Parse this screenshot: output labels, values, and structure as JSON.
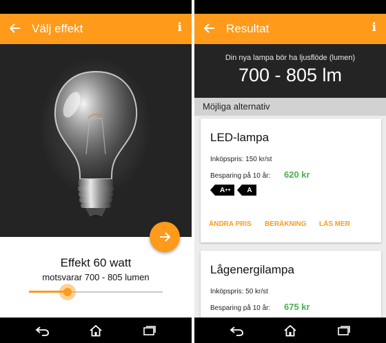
{
  "left_screen": {
    "appbar": {
      "title": "Välj effekt",
      "info": "i"
    },
    "effect_label": "Effekt 60 watt",
    "lumen_label": "motsvarar 700 - 805 lumen",
    "slider": {
      "value_fraction": 0.29
    }
  },
  "right_screen": {
    "appbar": {
      "title": "Resultat",
      "info": "i"
    },
    "header": {
      "caption": "Din nya lampa bör ha ljusflöde (lumen)",
      "value": "700 - 805 lm"
    },
    "section_label": "Möjliga alternativ",
    "cards": [
      {
        "name": "LED-lampa",
        "price": "Inköpspris: 150 kr/st",
        "saving_label": "Besparing på 10 år:",
        "saving_value": "620 kr",
        "energy_classes": [
          {
            "letter": "A",
            "plus": "++"
          },
          {
            "letter": "A",
            "plus": ""
          }
        ],
        "actions": [
          "ÄNDRA PRIS",
          "BERÄKNING",
          "LÄS MER"
        ]
      },
      {
        "name": "Lågenergilampa",
        "price": "Inköpspris: 50 kr/st",
        "saving_label": "Besparing på 10 år:",
        "saving_value": "675 kr"
      }
    ]
  },
  "colors": {
    "accent": "#ff9a1a",
    "saving_green": "#4caf50",
    "dark_panel": "#242424"
  },
  "icons": {
    "back": "arrow-left-icon",
    "next": "arrow-right-icon",
    "nav_back": "nav-back-icon",
    "nav_home": "nav-home-icon",
    "nav_recents": "nav-recents-icon"
  }
}
